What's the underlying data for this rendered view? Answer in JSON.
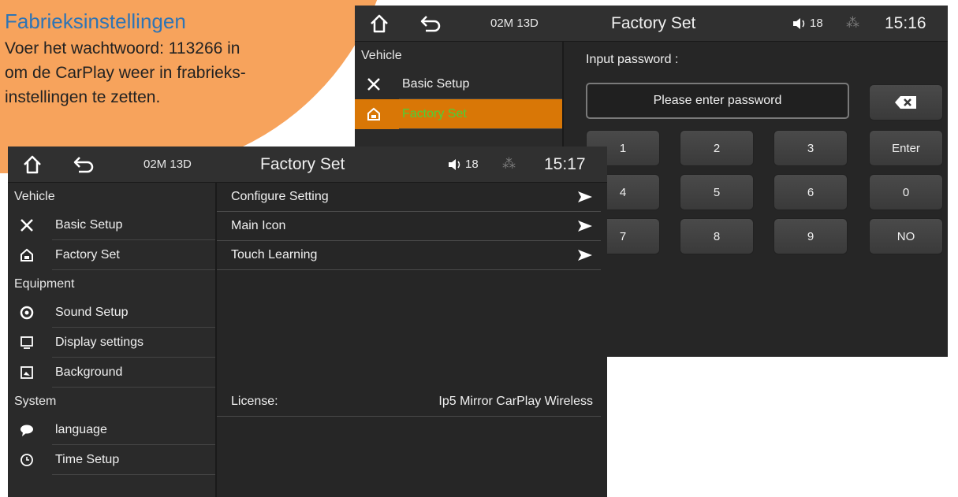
{
  "note": {
    "title": "Fabrieksinstellingen",
    "lines": [
      "Voer het wachtwoord: 113266 in",
      "om de CarPlay weer in frabrieks-",
      "instellingen te zetten."
    ]
  },
  "back_screen": {
    "status": {
      "date": "02M 13D",
      "title": "Factory Set",
      "volume": "18",
      "time": "15:16"
    },
    "sidebar": {
      "section": "Vehicle",
      "items": [
        {
          "label": "Basic Setup",
          "icon": "tools-icon"
        },
        {
          "label": "Factory Set",
          "icon": "factory-icon",
          "active": true
        }
      ]
    },
    "password": {
      "label": "Input password :",
      "placeholder": "Please enter password"
    },
    "keypad": [
      "1",
      "2",
      "3",
      "Enter",
      "4",
      "5",
      "6",
      "0",
      "7",
      "8",
      "9",
      "NO"
    ]
  },
  "front_screen": {
    "status": {
      "date": "02M 13D",
      "title": "Factory Set",
      "volume": "18",
      "time": "15:17"
    },
    "sidebar": {
      "sections": [
        {
          "title": "Vehicle",
          "items": [
            {
              "label": "Basic Setup",
              "icon": "tools-icon"
            },
            {
              "label": "Factory Set",
              "icon": "factory-icon"
            }
          ]
        },
        {
          "title": "Equipment",
          "items": [
            {
              "label": "Sound Setup",
              "icon": "speaker-icon"
            },
            {
              "label": "Display settings",
              "icon": "display-icon"
            },
            {
              "label": "Background",
              "icon": "background-icon"
            }
          ]
        },
        {
          "title": "System",
          "items": [
            {
              "label": "language",
              "icon": "speech-bubble-icon"
            },
            {
              "label": "Time Setup",
              "icon": "clock-icon"
            }
          ]
        }
      ]
    },
    "menu": [
      "Configure Setting",
      "Main Icon",
      "Touch Learning"
    ],
    "license": {
      "label": "License:",
      "value": "Ip5 Mirror CarPlay Wireless"
    }
  },
  "colors": {
    "accent": "#d97706",
    "active_text": "#4cd137",
    "note_title": "#2e74b5",
    "panel": "#262626"
  }
}
